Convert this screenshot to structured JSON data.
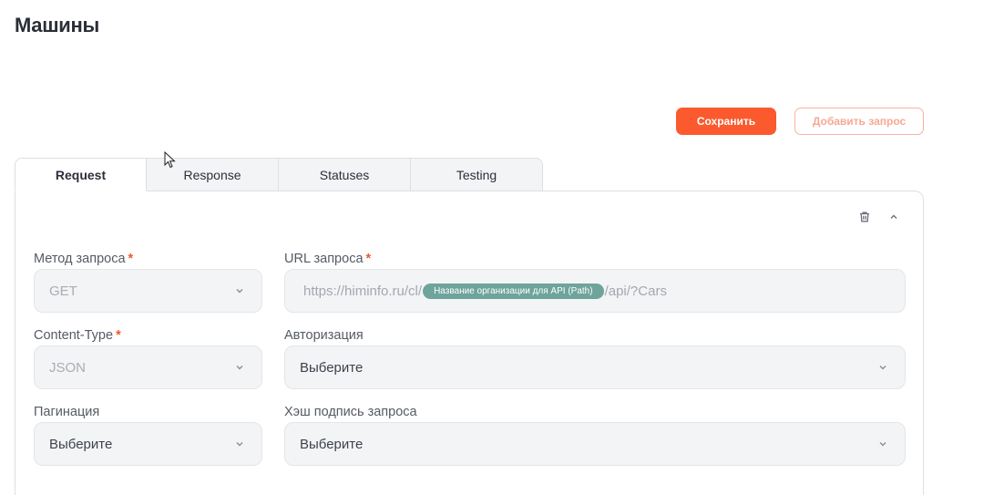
{
  "page": {
    "title": "Машины"
  },
  "actions": {
    "save_label": "Сохранить",
    "add_request_label": "Добавить запрос"
  },
  "tabs": [
    {
      "label": "Request",
      "active": true
    },
    {
      "label": "Response",
      "active": false
    },
    {
      "label": "Statuses",
      "active": false
    },
    {
      "label": "Testing",
      "active": false
    }
  ],
  "panel": {
    "icons": [
      "trash-icon",
      "chevron-up-icon"
    ]
  },
  "form": {
    "method": {
      "label": "Метод запроса",
      "required_mark": "*",
      "value": "GET",
      "disabled": true
    },
    "url": {
      "label": "URL запроса",
      "required_mark": "*",
      "prefix": "https://himinfo.ru/cl/",
      "path_param": "Название организации для API (Path)",
      "suffix": "/api/?Cars"
    },
    "content_type": {
      "label": "Content-Type",
      "required_mark": "*",
      "value": "JSON",
      "disabled": true
    },
    "authorization": {
      "label": "Авторизация",
      "value": "Выберите"
    },
    "pagination": {
      "label": "Пагинация",
      "value": "Выберите"
    },
    "hash_signature": {
      "label": "Хэш подпись запроса",
      "value": "Выберите"
    }
  },
  "colors": {
    "accent": "#fa5a2d",
    "pill": "#6ea49b",
    "required": "#f4562b"
  }
}
